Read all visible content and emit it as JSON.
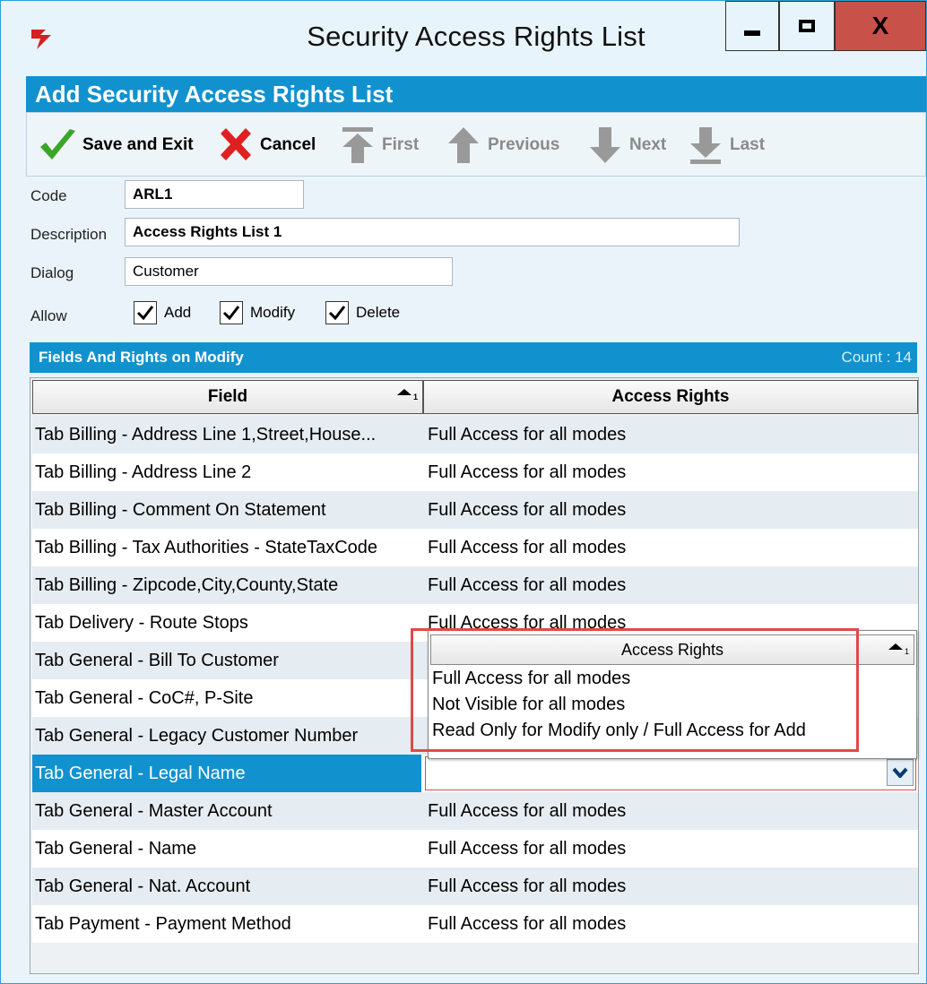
{
  "window": {
    "title": "Security Access Rights List",
    "close_label": "X"
  },
  "subheader": {
    "title": "Add Security Access Rights List"
  },
  "toolbar": {
    "save_label": "Save and Exit",
    "cancel_label": "Cancel",
    "first_label": "First",
    "previous_label": "Previous",
    "next_label": "Next",
    "last_label": "Last"
  },
  "form": {
    "code_label": "Code",
    "code_value": "ARL1",
    "description_label": "Description",
    "description_value": "Access Rights List 1",
    "dialog_label": "Dialog",
    "dialog_value": "Customer",
    "allow_label": "Allow",
    "allow_add": {
      "label": "Add",
      "checked": true
    },
    "allow_modify": {
      "label": "Modify",
      "checked": true
    },
    "allow_delete": {
      "label": "Delete",
      "checked": true
    }
  },
  "grid": {
    "title": "Fields And Rights on Modify",
    "count": "Count : 14",
    "columns": [
      "Field",
      "Access Rights"
    ],
    "rows": [
      {
        "field": "Tab Billing - Address Line 1,Street,House...",
        "rights": "Full Access for all modes"
      },
      {
        "field": "Tab Billing - Address Line 2",
        "rights": "Full Access for all modes"
      },
      {
        "field": "Tab Billing - Comment On Statement",
        "rights": "Full Access for all modes"
      },
      {
        "field": "Tab Billing - Tax Authorities - StateTaxCode",
        "rights": "Full Access for all modes"
      },
      {
        "field": "Tab Billing - Zipcode,City,County,State",
        "rights": "Full Access for all modes"
      },
      {
        "field": "Tab Delivery - Route Stops",
        "rights": "Full Access for all modes"
      },
      {
        "field": "Tab General - Bill To Customer",
        "rights": ""
      },
      {
        "field": "Tab General - CoC#, P-Site",
        "rights": ""
      },
      {
        "field": "Tab General - Legacy Customer Number",
        "rights": ""
      },
      {
        "field": "Tab General - Legal Name",
        "rights": ""
      },
      {
        "field": "Tab General - Master Account",
        "rights": "Full Access for all modes"
      },
      {
        "field": "Tab General - Name",
        "rights": "Full Access for all modes"
      },
      {
        "field": "Tab General - Nat. Account",
        "rights": "Full Access for all modes"
      },
      {
        "field": "Tab Payment - Payment Method",
        "rights": "Full Access for all modes"
      }
    ]
  },
  "popup": {
    "header": "Access Rights",
    "options": [
      "Full Access for all modes",
      "Not Visible for all modes",
      "Read Only for Modify only / Full Access for Add"
    ]
  },
  "colors": {
    "accent": "#1192cf",
    "close": "#c8514a",
    "highlight": "#e04a48",
    "check_green": "#3aa629",
    "cancel_red": "#e02020"
  }
}
